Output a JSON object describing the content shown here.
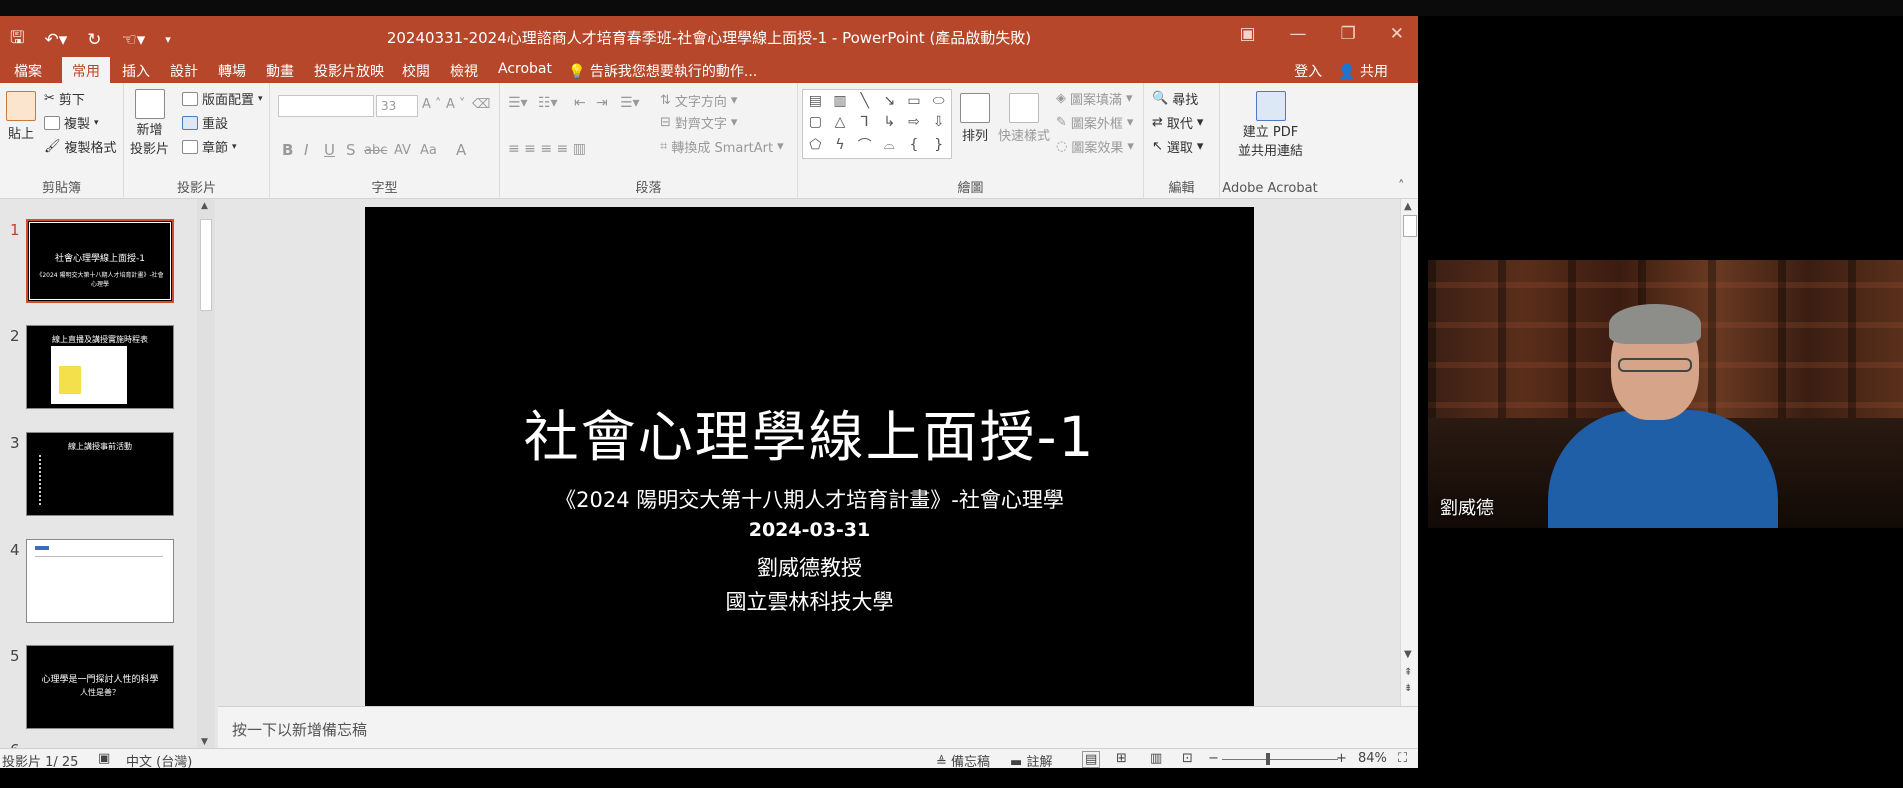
{
  "window": {
    "title": "20240331-2024心理諮商人才培育春季班-社會心理學線上面授-1 - PowerPoint (產品啟動失敗)",
    "qat_icons": [
      "save-icon",
      "undo-icon",
      "redo-icon",
      "touch-mode-icon",
      "customize-icon"
    ],
    "controls": [
      "ribbon-display-icon",
      "minimize-icon",
      "restore-icon",
      "close-icon"
    ]
  },
  "menu": {
    "tabs": [
      "檔案",
      "常用",
      "插入",
      "設計",
      "轉場",
      "動畫",
      "投影片放映",
      "校閱",
      "檢視",
      "Acrobat"
    ],
    "active": "常用",
    "tell_me": "告訴我您想要執行的動作...",
    "sign_in": "登入",
    "share": "共用"
  },
  "ribbon": {
    "clipboard": {
      "label": "剪貼簿",
      "paste": "貼上",
      "cut": "剪下",
      "copy": "複製",
      "format_painter": "複製格式"
    },
    "slides": {
      "label": "投影片",
      "new_slide_1": "新增",
      "new_slide_2": "投影片",
      "layout": "版面配置",
      "reset": "重設",
      "section": "章節"
    },
    "font": {
      "label": "字型",
      "font_size": "33",
      "bold": "B",
      "italic": "I",
      "underline": "U",
      "strike": "S",
      "abc": "abc",
      "spacing": "AV",
      "case": "Aa",
      "color": "A",
      "grow": "A",
      "shrink": "A"
    },
    "paragraph": {
      "label": "段落",
      "text_direction": "文字方向",
      "align_text": "對齊文字",
      "smartart": "轉換成 SmartArt"
    },
    "drawing": {
      "label": "繪圖",
      "arrange": "排列",
      "quick_styles": "快速樣式",
      "shape_fill": "圖案填滿",
      "shape_outline": "圖案外框",
      "shape_effects": "圖案效果"
    },
    "editing": {
      "label": "編輯",
      "find": "尋找",
      "replace": "取代",
      "select": "選取"
    },
    "acrobat": {
      "label": "Adobe Acrobat",
      "create_pdf_1": "建立 PDF",
      "create_pdf_2": "並共用連結"
    }
  },
  "thumbnails": [
    {
      "num": "1",
      "title": "社會心理學線上面授-1",
      "sub": "《2024 陽明交大第十八期人才培育計畫》-社會心理學",
      "selected": true
    },
    {
      "num": "2",
      "title": "線上直播及講授實施時程表",
      "sub": "",
      "selected": false
    },
    {
      "num": "3",
      "title": "線上講授事前活動",
      "sub": "",
      "selected": false
    },
    {
      "num": "4",
      "title": "",
      "sub": "",
      "selected": false
    },
    {
      "num": "5",
      "title": "心理學是一門探討人性的科學",
      "sub": "人性是善？",
      "selected": false
    },
    {
      "num": "6",
      "title": "",
      "sub": "",
      "selected": false
    }
  ],
  "slide": {
    "title": "社會心理學線上面授-1",
    "subtitle": "《2024 陽明交大第十八期人才培育計畫》-社會心理學",
    "date": "2024-03-31",
    "presenter": "劉威德教授",
    "institution": "國立雲林科技大學"
  },
  "notes_placeholder": "按一下以新增備忘稿",
  "status": {
    "slide_count": "投影片 1/ 25",
    "language": "中文 (台灣)",
    "notes_btn": "備忘稿",
    "comments_btn": "註解",
    "zoom": "84%",
    "zoom_fraction": 0.84,
    "minus": "−",
    "plus": "+"
  },
  "video": {
    "name": "劉威德"
  }
}
